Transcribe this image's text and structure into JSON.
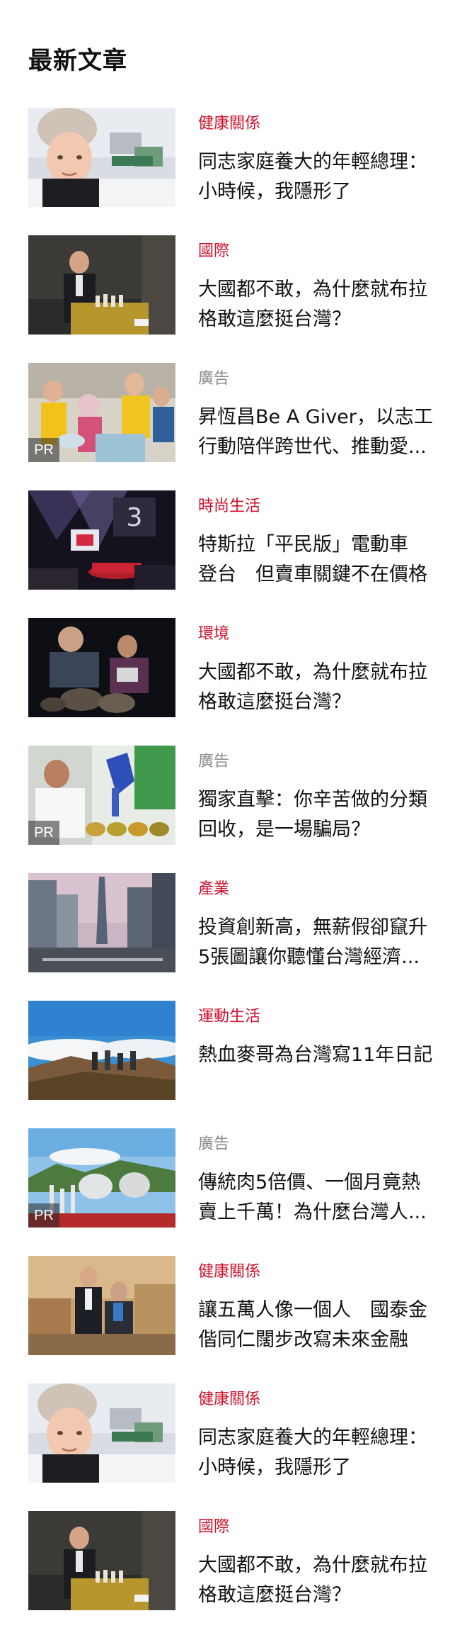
{
  "section": {
    "heading": "最新文章"
  },
  "articles": [
    {
      "category": "健康關係",
      "is_ad": false,
      "title_line1": "同志家庭養大的年輕總理：",
      "title_line2": "小時候，我隱形了",
      "pr": "",
      "scene": "woman-selfie"
    },
    {
      "category": "國際",
      "is_ad": false,
      "title_line1": "大國都不敢，為什麼就布拉",
      "title_line2": "格敢這麼挺台灣？",
      "pr": "",
      "scene": "man-podium"
    },
    {
      "category": "廣告",
      "is_ad": true,
      "title_line1": "昇恆昌Be A Giver，以志工",
      "title_line2": "行動陪伴跨世代、推動愛...",
      "pr": "PR",
      "scene": "volunteers"
    },
    {
      "category": "時尚生活",
      "is_ad": false,
      "title_line1": "特斯拉「平民版」電動車",
      "title_line2": "登台　但賣車關鍵不在價格",
      "pr": "",
      "scene": "car-stage"
    },
    {
      "category": "環境",
      "is_ad": false,
      "title_line1": "大國都不敢，為什麼就布拉",
      "title_line2": "格敢這麼挺台灣？",
      "pr": "",
      "scene": "night-animals"
    },
    {
      "category": "廣告",
      "is_ad": true,
      "title_line1": "獨家直擊：你辛苦做的分類",
      "title_line2": "回收，是一場騙局？",
      "pr": "PR",
      "scene": "lab-glove"
    },
    {
      "category": "產業",
      "is_ad": false,
      "title_line1": "投資創新高，無薪假卻竄升",
      "title_line2": "5張圖讓你聽懂台灣經濟...",
      "pr": "",
      "scene": "city-tower"
    },
    {
      "category": "運動生活",
      "is_ad": false,
      "title_line1": "熱血麥哥為台灣寫11年日記",
      "title_line2": "",
      "pr": "",
      "scene": "mountain-hikers"
    },
    {
      "category": "廣告",
      "is_ad": true,
      "title_line1": "傳統肉5倍價、一個月竟熱",
      "title_line2": "賣上千萬！為什麼台灣人...",
      "pr": "PR",
      "scene": "power-plant"
    },
    {
      "category": "健康關係",
      "is_ad": false,
      "title_line1": "讓五萬人像一個人　國泰金",
      "title_line2": "偕同仁闊步改寫未來金融",
      "pr": "",
      "scene": "two-men"
    },
    {
      "category": "健康關係",
      "is_ad": false,
      "title_line1": "同志家庭養大的年輕總理：",
      "title_line2": "小時候，我隱形了",
      "pr": "",
      "scene": "woman-selfie"
    },
    {
      "category": "國際",
      "is_ad": false,
      "title_line1": "大國都不敢，為什麼就布拉",
      "title_line2": "格敢這麼挺台灣？",
      "pr": "",
      "scene": "man-podium"
    }
  ]
}
